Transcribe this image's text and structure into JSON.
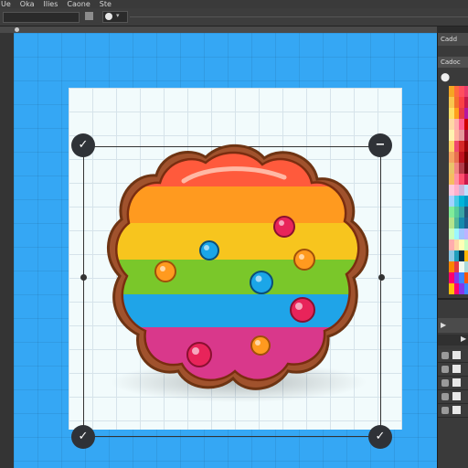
{
  "menu": {
    "items": [
      "Ue",
      "Oka",
      "Ilies",
      "Caone",
      "Ste"
    ]
  },
  "rightpanel": {
    "tab1": "Cadd",
    "tab2": "Cadoc"
  },
  "swatches": [
    [
      "#f5a623",
      "#ff6b3d",
      "#ff4f5e",
      "#e83b6b"
    ],
    [
      "#f9c74f",
      "#f3722c",
      "#f94144",
      "#c9184a"
    ],
    [
      "#ffe066",
      "#ff9f1c",
      "#e63946",
      "#b5179e"
    ],
    [
      "#ffd6a5",
      "#ffadad",
      "#ff5d8f",
      "#d00000"
    ],
    [
      "#fff3b0",
      "#ffb4a2",
      "#e5989b",
      "#a4133c"
    ],
    [
      "#ffd166",
      "#ef476f",
      "#d62828",
      "#9d0208"
    ],
    [
      "#f4a261",
      "#e76f51",
      "#c1121f",
      "#780000"
    ],
    [
      "#e9c46a",
      "#f28482",
      "#b23a48",
      "#6a040f"
    ],
    [
      "#f6bd60",
      "#ff8fa3",
      "#ff4d6d",
      "#c9184a"
    ],
    [
      "#ffc8dd",
      "#ffafcc",
      "#cdb4db",
      "#bde0fe"
    ],
    [
      "#a2d2ff",
      "#48cae4",
      "#00b4d8",
      "#0096c7"
    ],
    [
      "#80ed99",
      "#57cc99",
      "#38a3a5",
      "#22577a"
    ],
    [
      "#b5e48c",
      "#52b69a",
      "#168aad",
      "#1e6091"
    ],
    [
      "#caffbf",
      "#9bf6ff",
      "#a0c4ff",
      "#bdb2ff"
    ],
    [
      "#ffadad",
      "#ffd6a5",
      "#fdffb6",
      "#caffbf"
    ],
    [
      "#8ecae6",
      "#219ebc",
      "#023047",
      "#ffb703"
    ],
    [
      "#fb8500",
      "#e63946",
      "#f1faee",
      "#a8dadc"
    ],
    [
      "#ff006e",
      "#8338ec",
      "#3a86ff",
      "#fb5607"
    ],
    [
      "#ffbe0b",
      "#ff006e",
      "#8338ec",
      "#3a86ff"
    ]
  ],
  "handles": {
    "top_left": "✓",
    "top_right": "−",
    "bottom_left": "✓",
    "bottom_right": "✓"
  }
}
